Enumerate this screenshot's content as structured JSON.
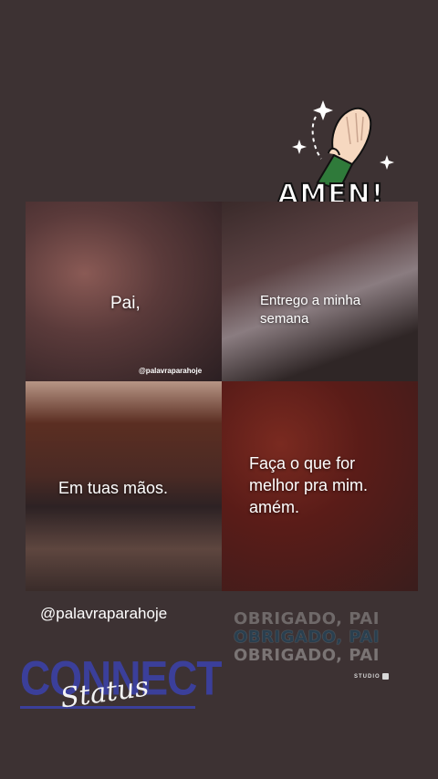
{
  "panels": [
    {
      "text": "Pai,"
    },
    {
      "text": "Entrego a minha\nsemana"
    },
    {
      "text": "Em tuas mãos."
    },
    {
      "text": "Faça o que for\nmelhor pra mim.\namém."
    }
  ],
  "panel_watermark": "@palavraparahoje",
  "handle": "@palavraparahoje",
  "sticker_amen": "AMEN!",
  "obrigado_lines": [
    "OBRIGADO, PAI",
    "OBRIGADO, PAI",
    "OBRIGADO, PAI"
  ],
  "studio_label": "STUDIO",
  "connect": {
    "word": "CONNECT",
    "script": "Status"
  },
  "colors": {
    "background": "#3d3233",
    "connect_blue": "#3b3f9a"
  }
}
